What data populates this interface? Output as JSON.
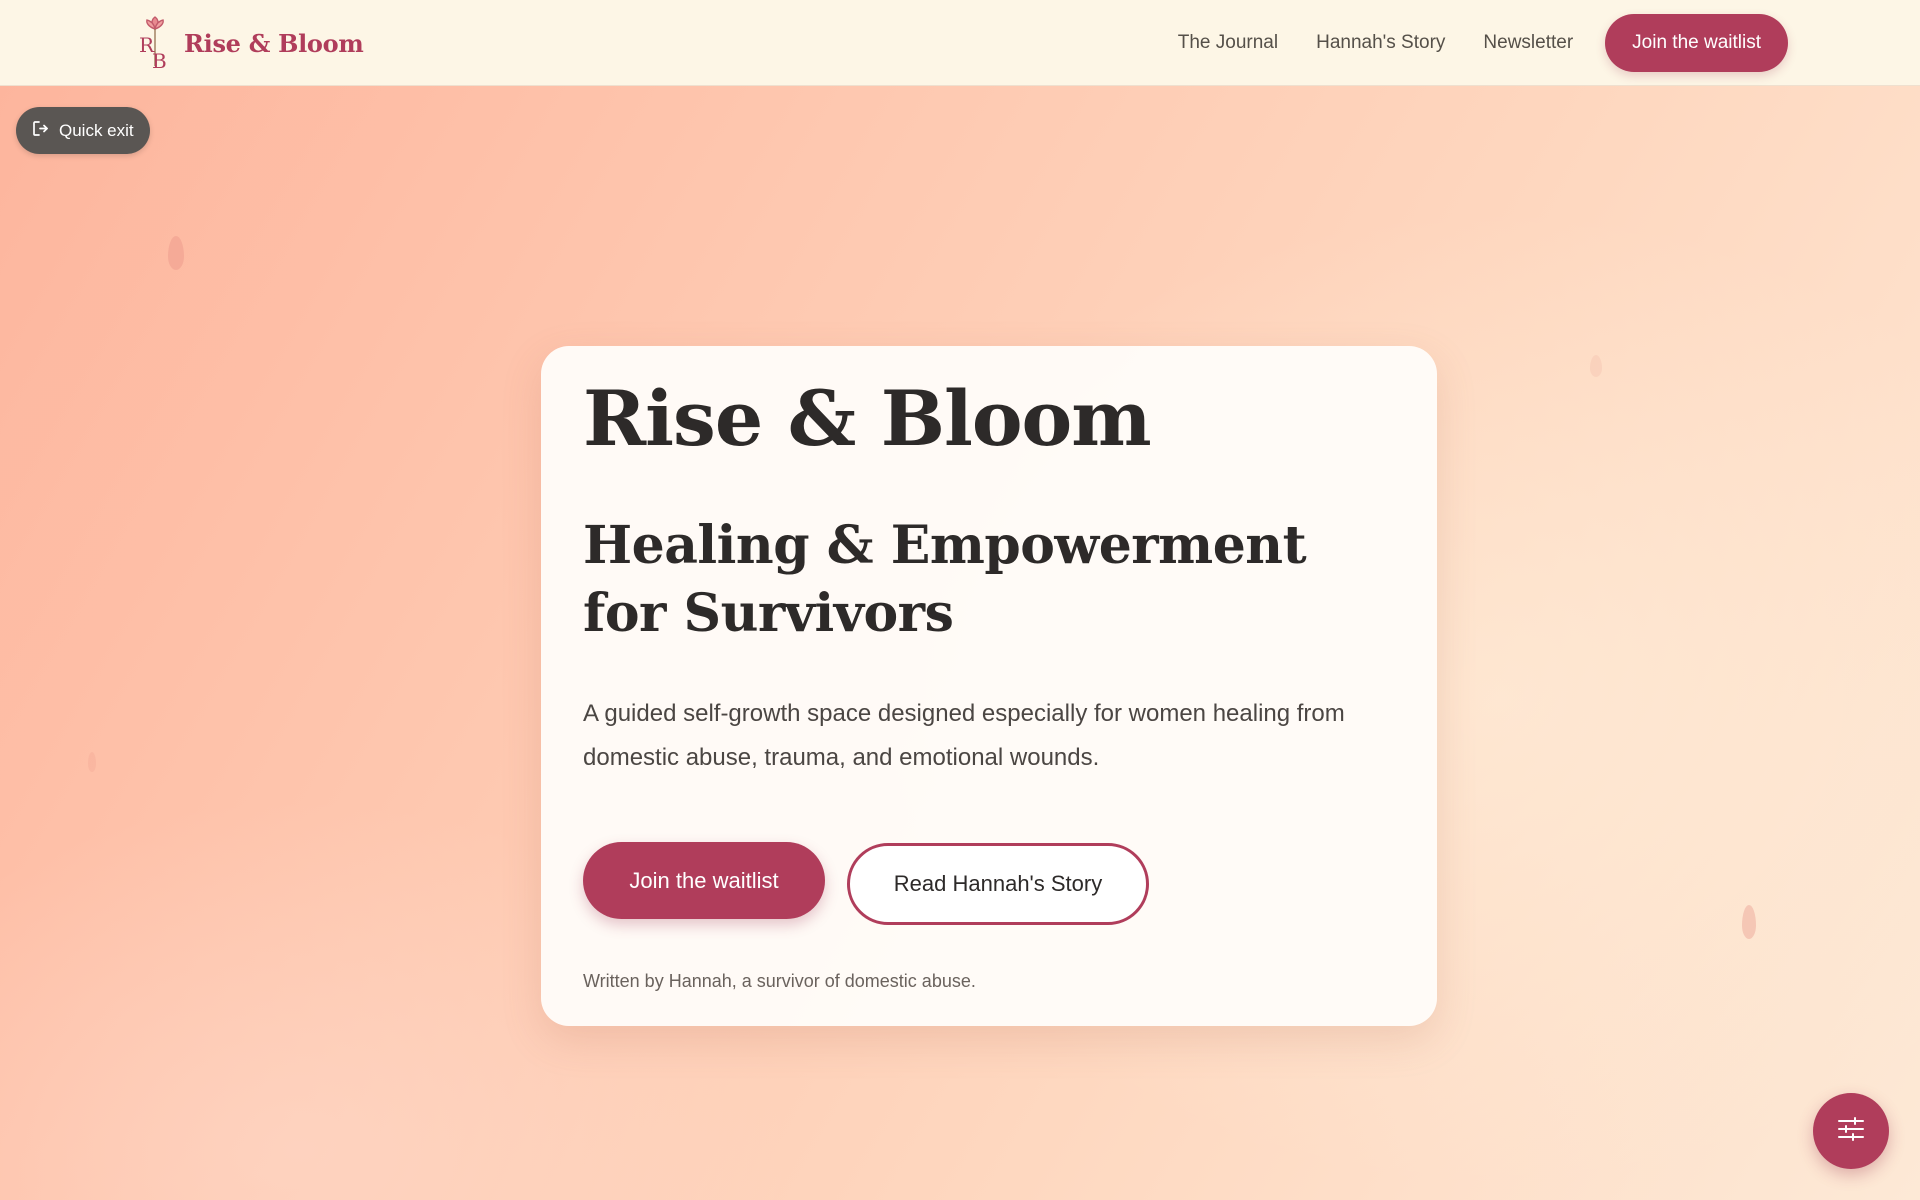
{
  "header": {
    "brand_name": "Rise & Bloom",
    "logo_icon": "lotus-monogram-icon",
    "nav": [
      {
        "label": "The Journal"
      },
      {
        "label": "Hannah's Story"
      },
      {
        "label": "Newsletter"
      }
    ],
    "cta_label": "Join the waitlist"
  },
  "quick_exit": {
    "label": "Quick exit",
    "icon": "exit-icon"
  },
  "hero": {
    "title": "Rise & Bloom",
    "subtitle": "Healing & Empowerment for Survivors",
    "description": "A guided self-growth space designed especially for women healing from domestic abuse, trauma, and emotional wounds.",
    "primary_button": "Join the waitlist",
    "secondary_button": "Read Hannah's Story",
    "byline": "Written by Hannah, a survivor of domestic abuse."
  },
  "fab": {
    "icon": "sliders-icon"
  },
  "colors": {
    "brand": "#b03d5b",
    "header_bg": "#fdf6e6",
    "text": "#2d2a29",
    "quick_exit_bg": "#5a5653"
  }
}
